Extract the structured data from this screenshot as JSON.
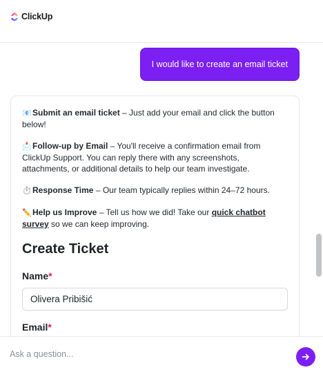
{
  "brand": {
    "name": "ClickUp",
    "logo_icon": "clickup-logo-icon",
    "colors": {
      "accent": "#7b1ff3",
      "logo_gradient": [
        "#8930fd",
        "#49ccf9",
        "#ff02f0",
        "#ffc800"
      ]
    }
  },
  "chat": {
    "user_message": "I would like to create an email ticket",
    "bot": {
      "paragraphs": [
        {
          "emoji": "📧",
          "icon": "email-icon",
          "title": "Submit an email ticket",
          "text": " – Just add your email and click the button below!"
        },
        {
          "emoji": "📩",
          "icon": "envelope-arrow-icon",
          "title": "Follow-up by Email",
          "text": " – You'll receive a confirmation email from ClickUp Support. You can reply there with any screenshots, attachments, or additional details to help our team investigate."
        },
        {
          "emoji": "⏱️",
          "icon": "stopwatch-icon",
          "title": "Response Time",
          "text": " – Our team typically replies within 24–72 hours."
        },
        {
          "emoji": "✏️",
          "icon": "pencil-icon",
          "title": "Help us Improve",
          "text_before": " – Tell us how we did! Take our ",
          "link": "quick chatbot survey",
          "text_after": " so we can keep improving."
        }
      ],
      "form": {
        "title": "Create Ticket",
        "name_label": "Name",
        "name_value": "Olivera Pribišić",
        "email_label": "Email",
        "required_mark": "*"
      }
    }
  },
  "composer": {
    "placeholder": "Ask a question...",
    "send_icon": "arrow-right-icon"
  }
}
